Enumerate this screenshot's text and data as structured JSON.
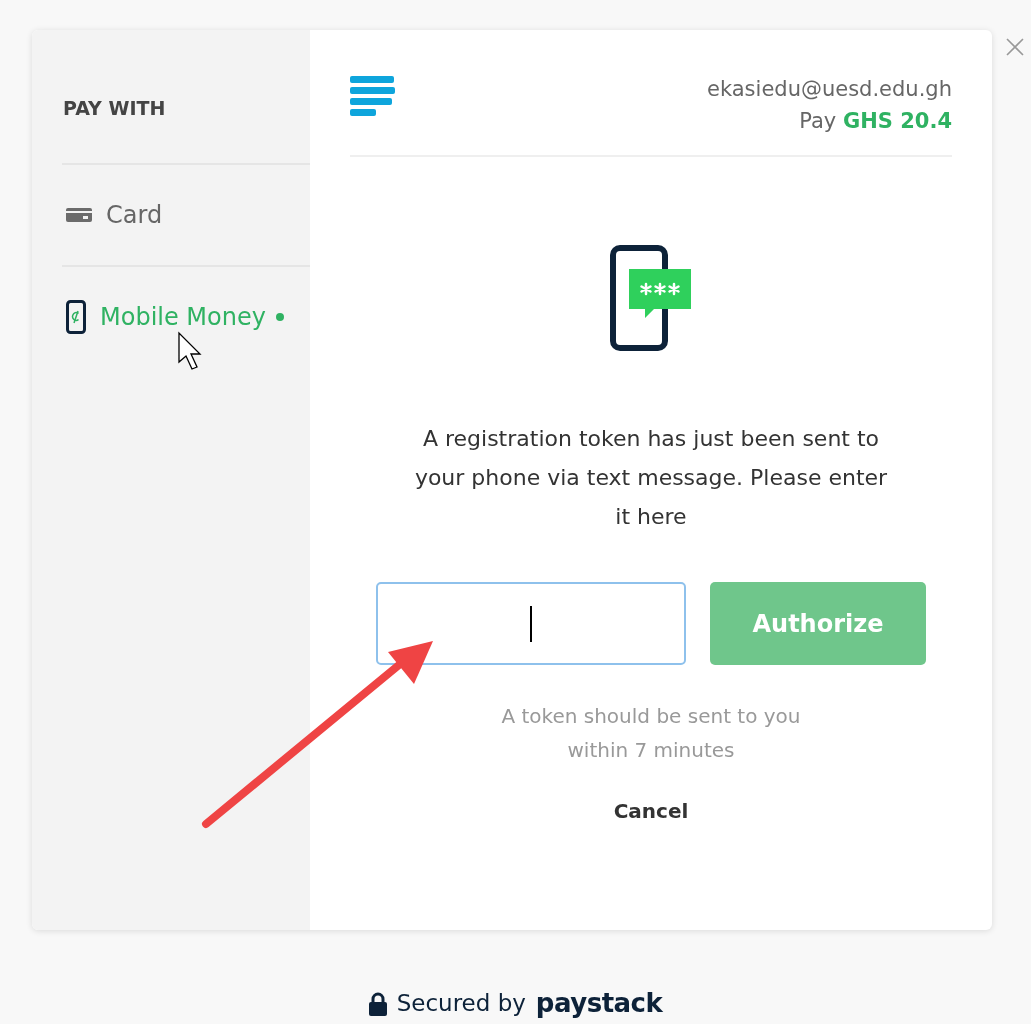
{
  "sidebar": {
    "title": "PAY WITH",
    "methods": [
      {
        "kind": "card",
        "label": "Card",
        "selected": false
      },
      {
        "kind": "mobile",
        "label": "Mobile Money",
        "selected": true
      }
    ]
  },
  "header": {
    "email": "ekasiedu@uesd.edu.gh",
    "amount": "Pay **GHS 20.4**"
  },
  "message": "A registration token has just been sent to your phone via text message. Please enter it here",
  "token_field": {
    "focused": true
  },
  "authorize_button": {
    "label": "Authorize",
    "disabled": true
  },
  "hint": "A token should be sent to you within 7 minutes",
  "cancel": "Cancel",
  "footer": {
    "secured_by": "Secured by",
    "brand": "paystack"
  }
}
